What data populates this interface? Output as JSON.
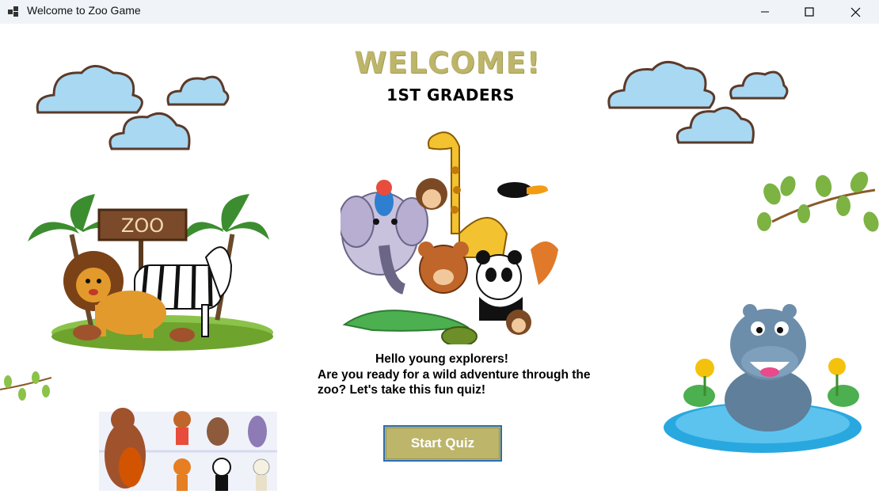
{
  "window": {
    "title": "Welcome to Zoo Game",
    "icon": "app-window-icon",
    "controls": [
      "minimize-icon",
      "maximize-icon",
      "close-icon"
    ]
  },
  "main": {
    "heading": "WELCOME!",
    "subheading": "1ST GRADERS",
    "message_line1": "Hello young explorers!",
    "message_line2": "Are you ready for a wild adventure through the zoo? Let's take this fun quiz!",
    "start_button_label": "Start Quiz"
  },
  "colors": {
    "accent": "#bdb56a",
    "button_border": "#2b6fb0",
    "titlebar_bg": "#f0f4f9"
  },
  "illustrations": [
    "clouds-left",
    "clouds-right",
    "zoo-sign-lion-zebra",
    "animal-group-center",
    "branch-right",
    "branch-left",
    "animal-band",
    "hippo-pond"
  ]
}
